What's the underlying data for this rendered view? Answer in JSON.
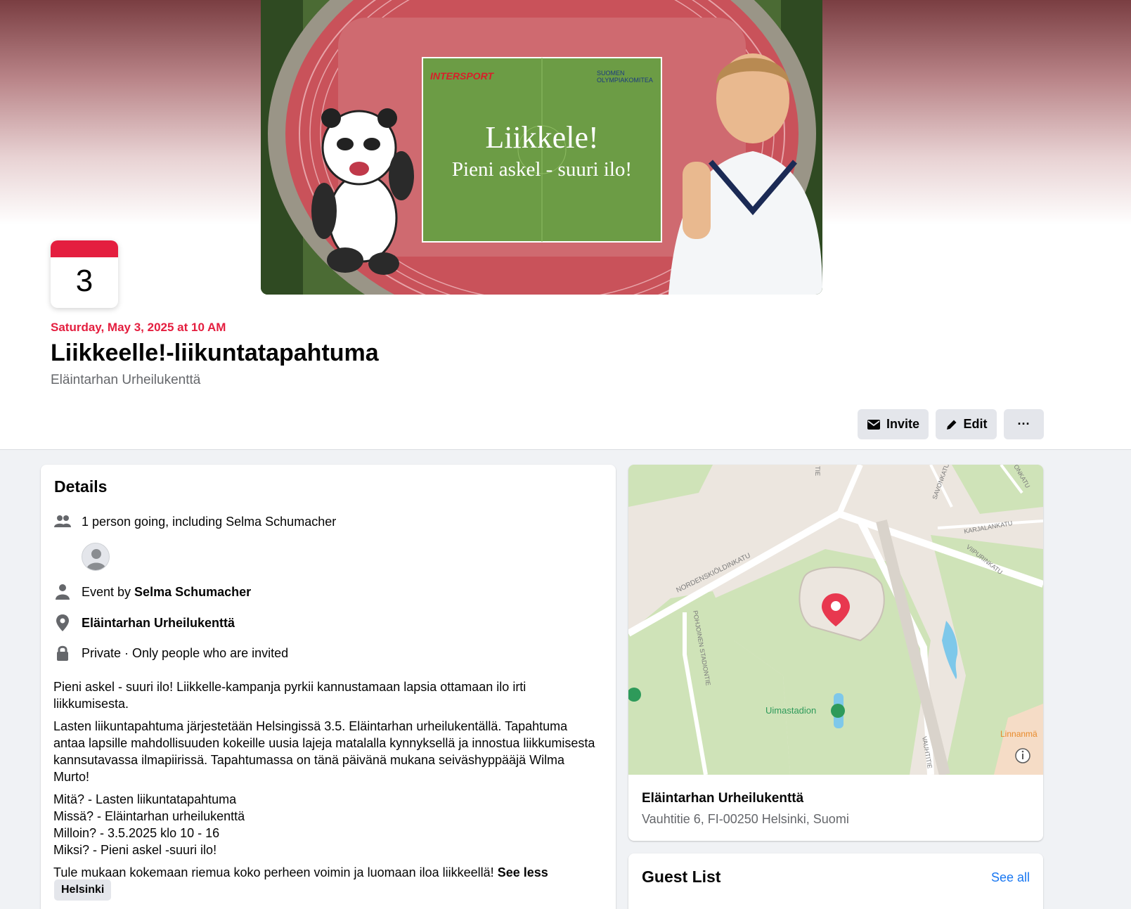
{
  "event": {
    "day_number": "3",
    "date_line": "Saturday, May 3, 2025 at 10 AM",
    "title": "Liikkeelle!-liikuntatapahtuma",
    "location": "Eläintarhan Urheilukenttä"
  },
  "cover": {
    "headline": "Liikkele!",
    "subline": "Pieni askel - suuri ilo!",
    "sponsor_left": "INTERSPORT",
    "sponsor_right_line1": "SUOMEN",
    "sponsor_right_line2": "OLYMPIAKOMITEA"
  },
  "actions": {
    "invite_label": "Invite",
    "edit_label": "Edit",
    "more_label": "···"
  },
  "details": {
    "heading": "Details",
    "going_text": "1 person going, including Selma Schumacher",
    "event_by_prefix": "Event by ",
    "event_by_name": "Selma Schumacher",
    "venue": "Eläintarhan Urheilukenttä",
    "privacy": "Private · Only people who are invited",
    "description": [
      "Pieni askel - suuri ilo! Liikkelle-kampanja pyrkii kannustamaan lapsia ottamaan ilo irti liikkumisesta.",
      "Lasten liikuntapahtuma järjestetään Helsingissä 3.5. Eläintarhan urheilukentällä. Tapahtuma antaa lapsille mahdollisuuden kokeille uusia lajeja matalalla kynnyksellä ja innostua liikkumisesta kannsutavassa ilmapiirissä. Tapahtumassa on tänä päivänä mukana seiväshyppääjä Wilma Murto!",
      "Mitä? - Lasten liikuntatapahtuma\nMissä? - Eläintarhan urheilukenttä\nMilloin? - 3.5.2025 klo 10 - 16\nMiksi? - Pieni askel -suuri ilo!"
    ],
    "closing": "Tule mukaan kokemaan riemua koko perheen voimin ja luomaan iloa liikkeellä!",
    "see_less": "See less",
    "tag": "Helsinki"
  },
  "map": {
    "street_labels": [
      "NORDENSKIÖLDINKATU",
      "POHJOINEN STADIONTIE",
      "KARJALANKATU",
      "VIIPURINKATU",
      "SAVONKATU",
      "VAUHTITIE",
      "TIE",
      "ONKATU"
    ],
    "poi_label": "Uimastadion",
    "edge_label": "Linnanmä",
    "venue_name": "Eläintarhan Urheilukenttä",
    "venue_address": "Vauhtitie 6, FI-00250 Helsinki, Suomi"
  },
  "guest_list": {
    "heading": "Guest List",
    "see_all": "See all"
  },
  "colors": {
    "accent_red": "#e41e3f",
    "link_blue": "#1877f2",
    "secondary_text": "#65676b",
    "button_bg": "#e4e6eb"
  },
  "icons": [
    "envelope-icon",
    "pencil-icon",
    "more-icon",
    "people-icon",
    "person-icon",
    "location-pin-icon",
    "lock-icon",
    "map-pin-icon",
    "info-icon"
  ]
}
